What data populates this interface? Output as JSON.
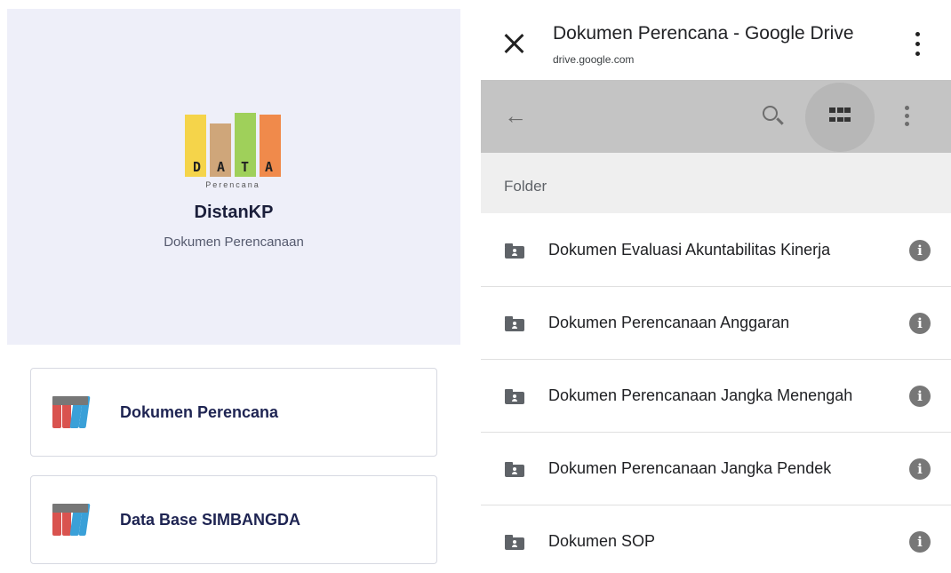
{
  "left": {
    "logo": {
      "letters": [
        "D",
        "A",
        "T",
        "A"
      ],
      "subtitle": "Perencana"
    },
    "app_title": "DistanKP",
    "app_subtitle": "Dokumen Perencanaan",
    "cards": [
      {
        "label": "Dokumen Perencana",
        "icon": "binders-icon"
      },
      {
        "label": "Data Base SIMBANGDA",
        "icon": "binders-icon"
      }
    ]
  },
  "browser": {
    "title": "Dokumen Perencana - Google Drive",
    "url": "drive.google.com"
  },
  "drive": {
    "section_label": "Folder",
    "folders": [
      {
        "name": "Dokumen Evaluasi Akuntabilitas Kinerja"
      },
      {
        "name": "Dokumen Perencanaan Anggaran"
      },
      {
        "name": "Dokumen Perencanaan Jangka Menengah"
      },
      {
        "name": "Dokumen Perencanaan Jangka Pendek"
      },
      {
        "name": "Dokumen SOP"
      }
    ]
  },
  "colors": {
    "hero_bg": "#eeeff9",
    "toolbar_bg": "#c4c4c4",
    "title_text": "#1e2452"
  }
}
